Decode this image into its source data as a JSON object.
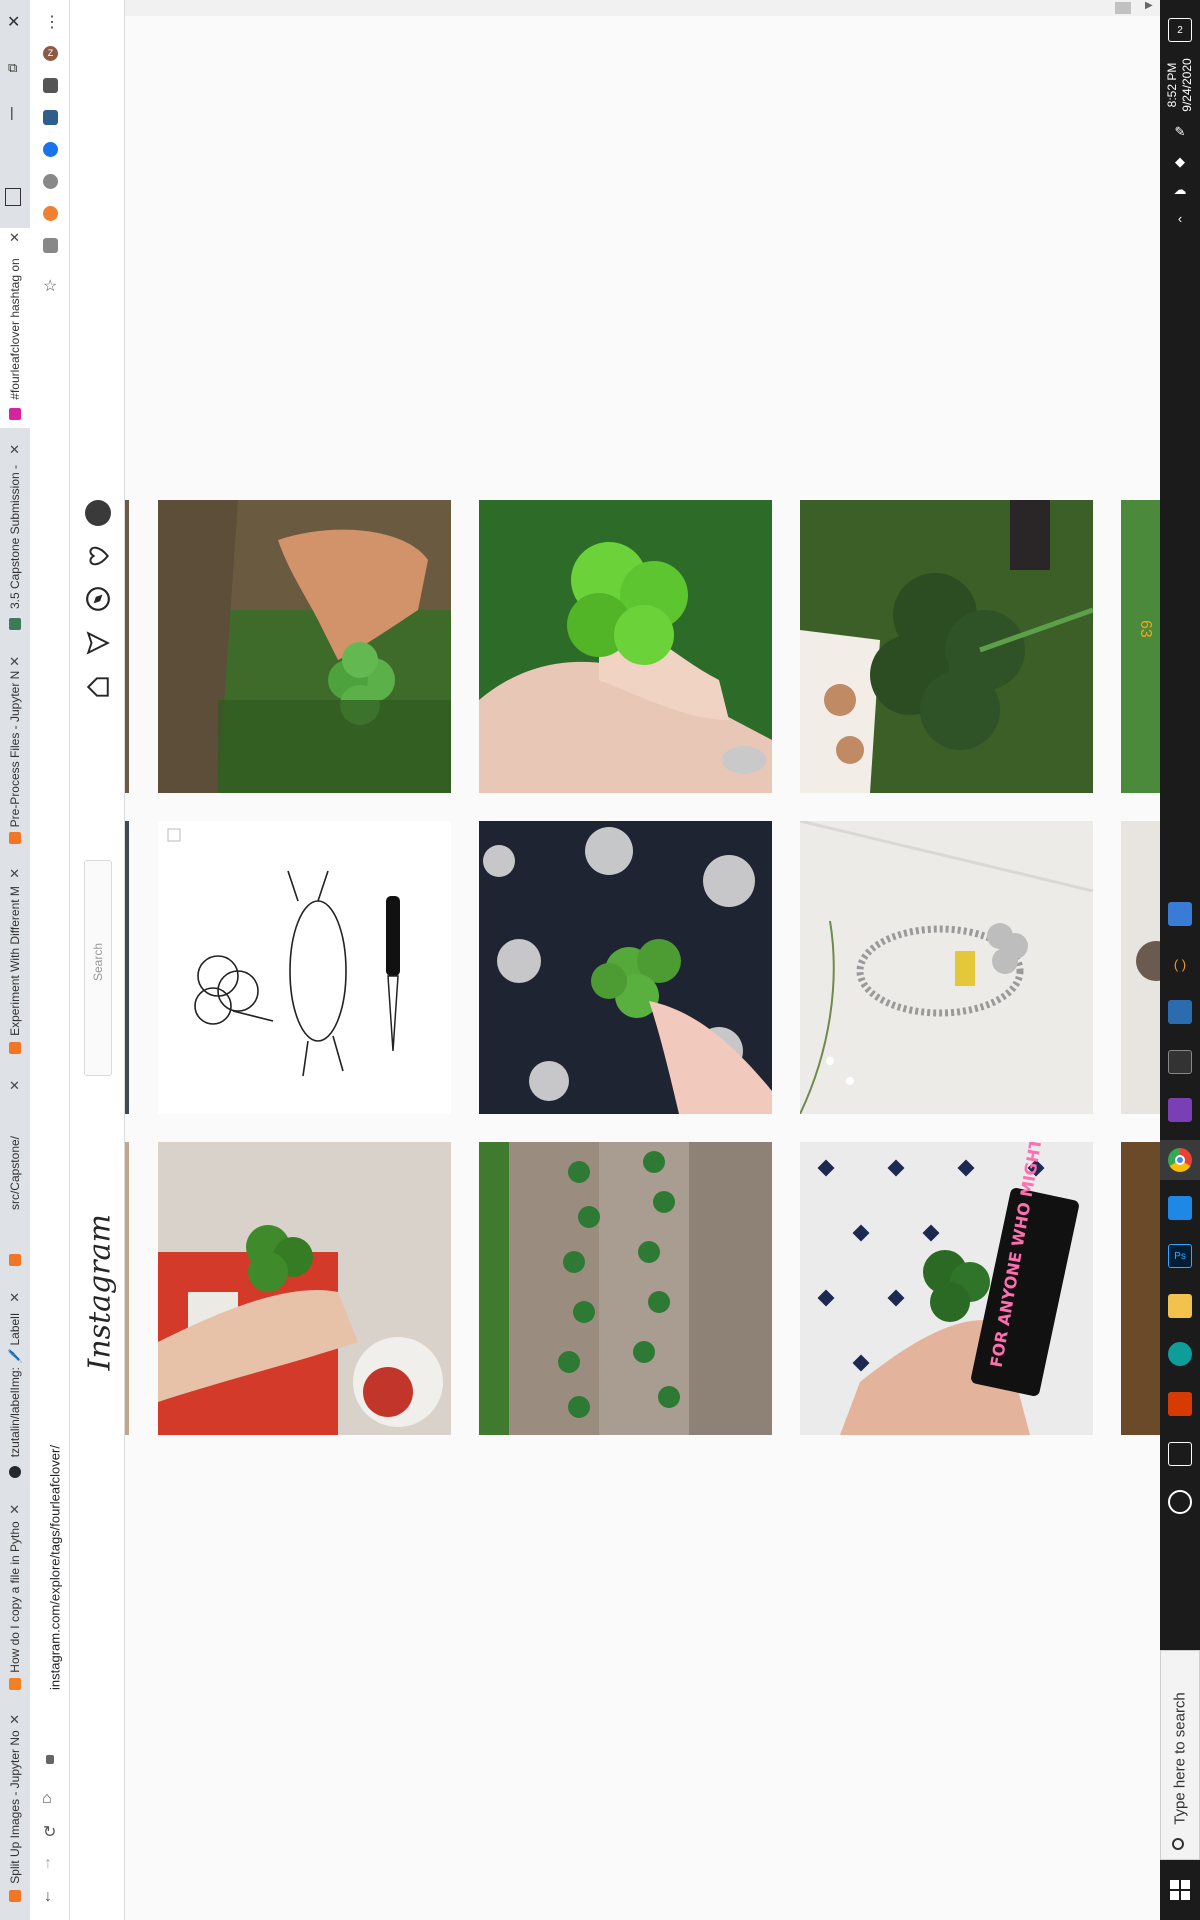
{
  "browser": {
    "url": "instagram.com/explore/tags/fourleafclover/",
    "tabs": [
      {
        "title": "#fourleafclover hashtag on",
        "favicon_color": "#d6249f",
        "active": true
      },
      {
        "title": "3.5 Capstone Submission -",
        "favicon_color": "#3c7a5a"
      },
      {
        "title": "Pre-Process Files - Jupyter N",
        "favicon_color": "#f37626"
      },
      {
        "title": "Experiment With Different M",
        "favicon_color": "#f37626"
      },
      {
        "title": "src/Capstone/",
        "favicon_color": "#f37626"
      },
      {
        "title": "tzutalin/labelImg: 🖊️ LabelI",
        "favicon_color": "#24292e"
      },
      {
        "title": "How do I copy a file in Pytho",
        "favicon_color": "#f48024"
      },
      {
        "title": "Split Up Images - Jupyter No",
        "favicon_color": "#f37626"
      }
    ]
  },
  "taskbar": {
    "search_placeholder": "Type here to search",
    "time": "8:52 PM",
    "date": "9/24/2020",
    "notifications": "2"
  },
  "instagram": {
    "logo": "Instagram",
    "search_placeholder": "Search",
    "posts": [
      {
        "subject": "hand picking clover from grass"
      },
      {
        "subject": "fingers holding four-leaf clover"
      },
      {
        "subject": "four-leaf clover over grass"
      },
      {
        "subject": "sketch of clover, rabbit and knife"
      },
      {
        "subject": "clover over paisley fabric"
      },
      {
        "subject": "clover charm bracelet"
      },
      {
        "subject": "clover held near red motorcycle"
      },
      {
        "subject": "clovers on wooden boards"
      },
      {
        "subject": "clover with sticker",
        "overlay_text": "FOR ANYONE WHO MIGHT NEED THIS TODAY"
      }
    ]
  }
}
